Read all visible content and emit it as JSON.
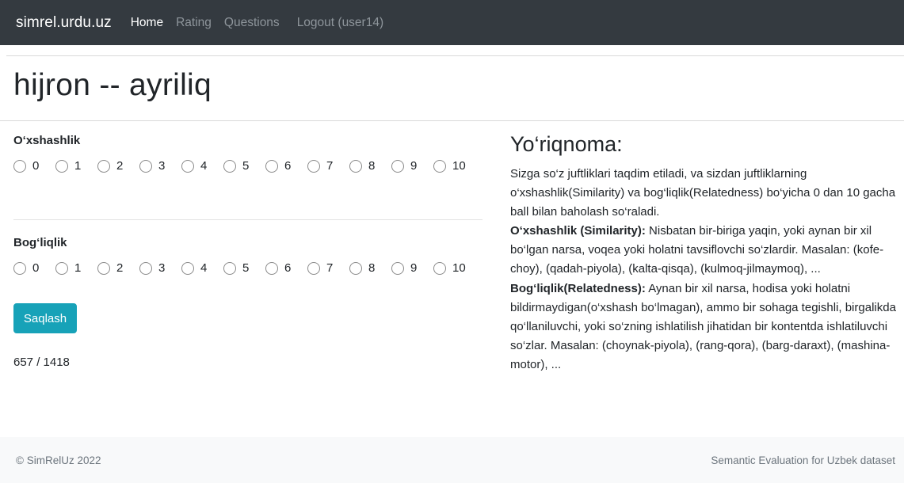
{
  "nav": {
    "brand": "simrel.urdu.uz",
    "links": [
      {
        "label": "Home",
        "active": true
      },
      {
        "label": "Rating",
        "active": false
      },
      {
        "label": "Questions",
        "active": false
      },
      {
        "label": "Logout (user14)",
        "active": false
      }
    ]
  },
  "page": {
    "title": "hijron -- ayriliq"
  },
  "form": {
    "similarity": {
      "label": "O‘xshashlik",
      "options": [
        "0",
        "1",
        "2",
        "3",
        "4",
        "5",
        "6",
        "7",
        "8",
        "9",
        "10"
      ]
    },
    "relatedness": {
      "label": "Bog‘liqlik",
      "options": [
        "0",
        "1",
        "2",
        "3",
        "4",
        "5",
        "6",
        "7",
        "8",
        "9",
        "10"
      ]
    },
    "save_label": "Saqlash",
    "counter": "657 / 1418"
  },
  "instructions": {
    "title": "Yo‘riqnoma:",
    "intro": "Sizga so‘z juftliklari taqdim etiladi, va sizdan juftliklarning o‘xshashlik(Similarity) va bog‘liqlik(Relatedness) bo‘yicha 0 dan 10 gacha ball bilan baholash so‘raladi.",
    "similarity_term": "O‘xshashlik (Similarity):",
    "similarity_text": " Nisbatan bir-biriga yaqin, yoki aynan bir xil bo‘lgan narsa, voqea yoki holatni tavsiflovchi so‘zlardir. Masalan: (kofe-choy), (qadah-piyola), (kalta-qisqa), (kulmoq-jilmaymoq), ...",
    "relatedness_term": "Bog‘liqlik(Relatedness):",
    "relatedness_text": " Aynan bir xil narsa, hodisa yoki holatni bildirmaydigan(o‘xshash bo‘lmagan), ammo bir sohaga tegishli, birgalikda qo‘llaniluvchi, yoki so‘zning ishlatilish jihatidan bir kontentda ishlatiluvchi so‘zlar. Masalan: (choynak-piyola), (rang-qora), (barg-daraxt), (mashina-motor), ..."
  },
  "footer": {
    "copyright": "© SimRelUz 2022",
    "tagline": "Semantic Evaluation for Uzbek dataset"
  }
}
